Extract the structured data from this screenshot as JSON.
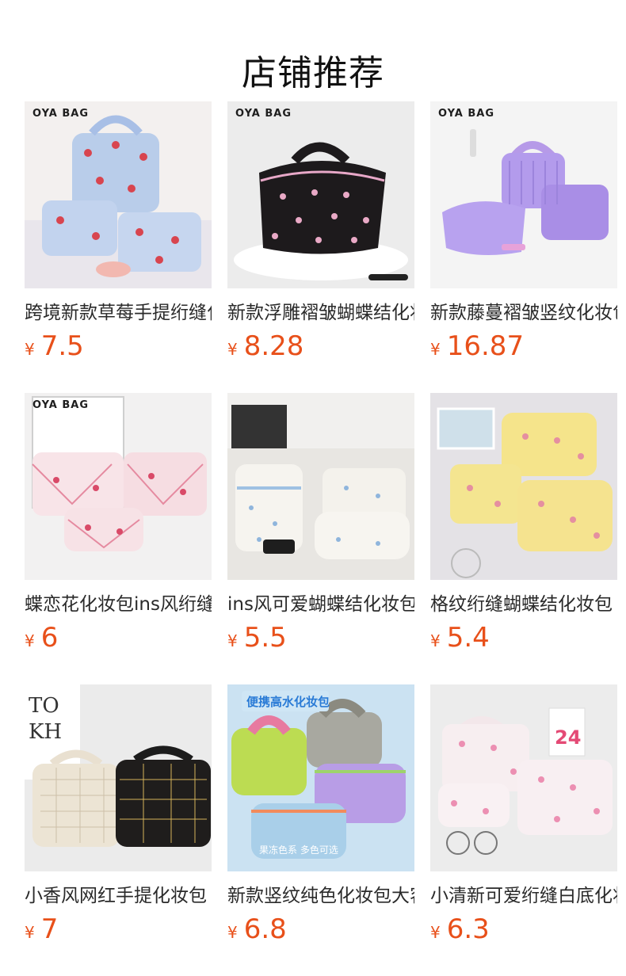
{
  "page": {
    "title": "店铺推荐"
  },
  "colors": {
    "price": "#e8501a",
    "title": "#111111",
    "text": "#2a2a2a"
  },
  "products": [
    {
      "name": "跨境新款草莓手提绗缝化妆包",
      "currency": "¥",
      "price": "7.5",
      "brand": "OYA BAG",
      "image": "strawberry-quilted-cosmetic-bags"
    },
    {
      "name": "新款浮雕褶皱蝴蝶结化妆包",
      "currency": "¥",
      "price": "8.28",
      "brand": "OYA BAG",
      "image": "black-bow-print-cosmetic-bag"
    },
    {
      "name": "新款藤蔓褶皱竖纹化妆包",
      "currency": "¥",
      "price": "16.87",
      "brand": "OYA BAG",
      "image": "purple-pleated-cosmetic-bags"
    },
    {
      "name": "蝶恋花化妆包ins风绗缝",
      "currency": "¥",
      "price": "6",
      "brand": "OYA BAG",
      "image": "pink-floral-lattice-cosmetic-bags"
    },
    {
      "name": "ins风可爱蝴蝶结化妆包",
      "currency": "¥",
      "price": "5.5",
      "brand": "",
      "image": "white-blue-bow-cosmetic-bags"
    },
    {
      "name": "格纹绗缝蝴蝶结化妆包",
      "currency": "¥",
      "price": "5.4",
      "brand": "",
      "image": "yellow-gingham-cosmetic-bags"
    },
    {
      "name": "小香风网红手提化妆包",
      "currency": "¥",
      "price": "7",
      "brand": "",
      "image": "tweed-cosmetic-bags"
    },
    {
      "name": "新款竖纹纯色化妆包大容量",
      "currency": "¥",
      "price": "6.8",
      "brand": "",
      "image": "colorful-pastel-cosmetic-bags",
      "overlay_top": "便携高水化妆包",
      "overlay_bottom": "果冻色系 多色可选"
    },
    {
      "name": "小清新可爱绗缝白底化妆包",
      "currency": "¥",
      "price": "6.3",
      "brand": "",
      "image": "white-pink-bow-cosmetic-bags"
    }
  ]
}
